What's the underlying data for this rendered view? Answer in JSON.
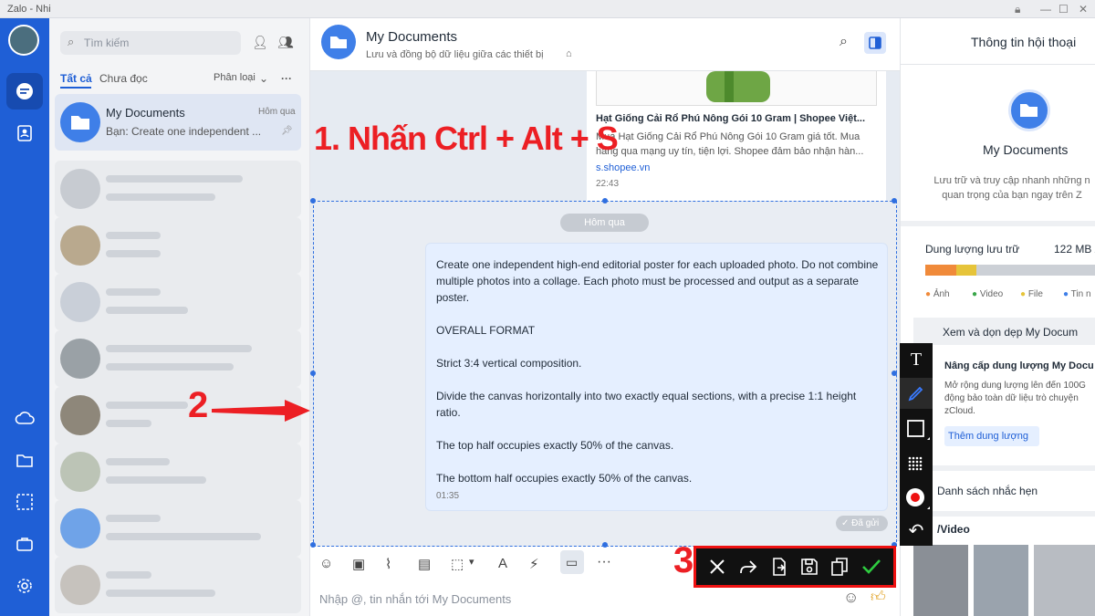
{
  "window": {
    "title": "Zalo - Nhi"
  },
  "sidebar": {
    "search_placeholder": "Tìm kiếm",
    "tabs": [
      "Tất cả",
      "Chưa đọc"
    ],
    "filter_label": "Phân loại",
    "active_item": {
      "name": "My Documents",
      "time": "Hôm qua",
      "preview": "Bạn: Create one independent ..."
    }
  },
  "chat": {
    "title": "My Documents",
    "subtitle": "Lưu và đồng bộ dữ liệu giữa các thiết bị",
    "link_preview": {
      "title": "Hạt Giống Cải Rổ Phú Nông Gói 10 Gram | Shopee Việt...",
      "desc": "Mua Hạt Giống Cải Rổ Phú Nông Gói 10 Gram giá tốt. Mua hàng qua mạng uy tín, tiện lợi. Shopee đảm bảo nhận hàn...",
      "domain": "s.shopee.vn",
      "time": "22:43"
    },
    "date_divider": "Hôm qua",
    "message": {
      "text": "Create one independent high-end editorial poster for each uploaded photo. Do not combine multiple photos into a collage. Each photo must be processed and output as a separate poster.\n\nOVERALL FORMAT\n\nStrict 3:4 vertical composition.\n\nDivide the canvas horizontally into two exactly equal sections, with a precise 1:1 height ratio.\n\nThe top half occupies exactly 50% of the canvas.\n\nThe bottom half occupies exactly 50% of the canvas.",
      "time": "01:35",
      "status": "Đã gửi"
    },
    "input_placeholder": "Nhập @, tin nhắn tới My Documents"
  },
  "info_panel": {
    "header": "Thông tin hội thoại",
    "name": "My Documents",
    "desc": "Lưu trữ và truy cập nhanh những n quan trọng của bạn ngay trên Z",
    "storage_label": "Dung lượng lưu trữ",
    "storage_value": "122 MB /",
    "legend": [
      "Ảnh",
      "Video",
      "File",
      "Tin n"
    ],
    "cleanup_title": "Xem và dọn dẹp My Docum",
    "upgrade_title": "Nâng cấp dung lượng My Docu",
    "upgrade_desc": "Mở rộng dung lượng lên đến 100G động bảo toàn dữ liệu trò chuyện zCloud.",
    "upgrade_button": "Thêm dung lượng",
    "reminders": "Danh sách nhắc hẹn",
    "media_label": "/Video"
  },
  "annotations": {
    "step1": "1. Nhấn Ctrl + Alt + S",
    "step2": "2",
    "step3": "3"
  },
  "colors": {
    "rail": "#1f5fd6",
    "selection": "#2f6fe0",
    "annotation": "#ec1f24",
    "confirm": "#2ecc40"
  }
}
